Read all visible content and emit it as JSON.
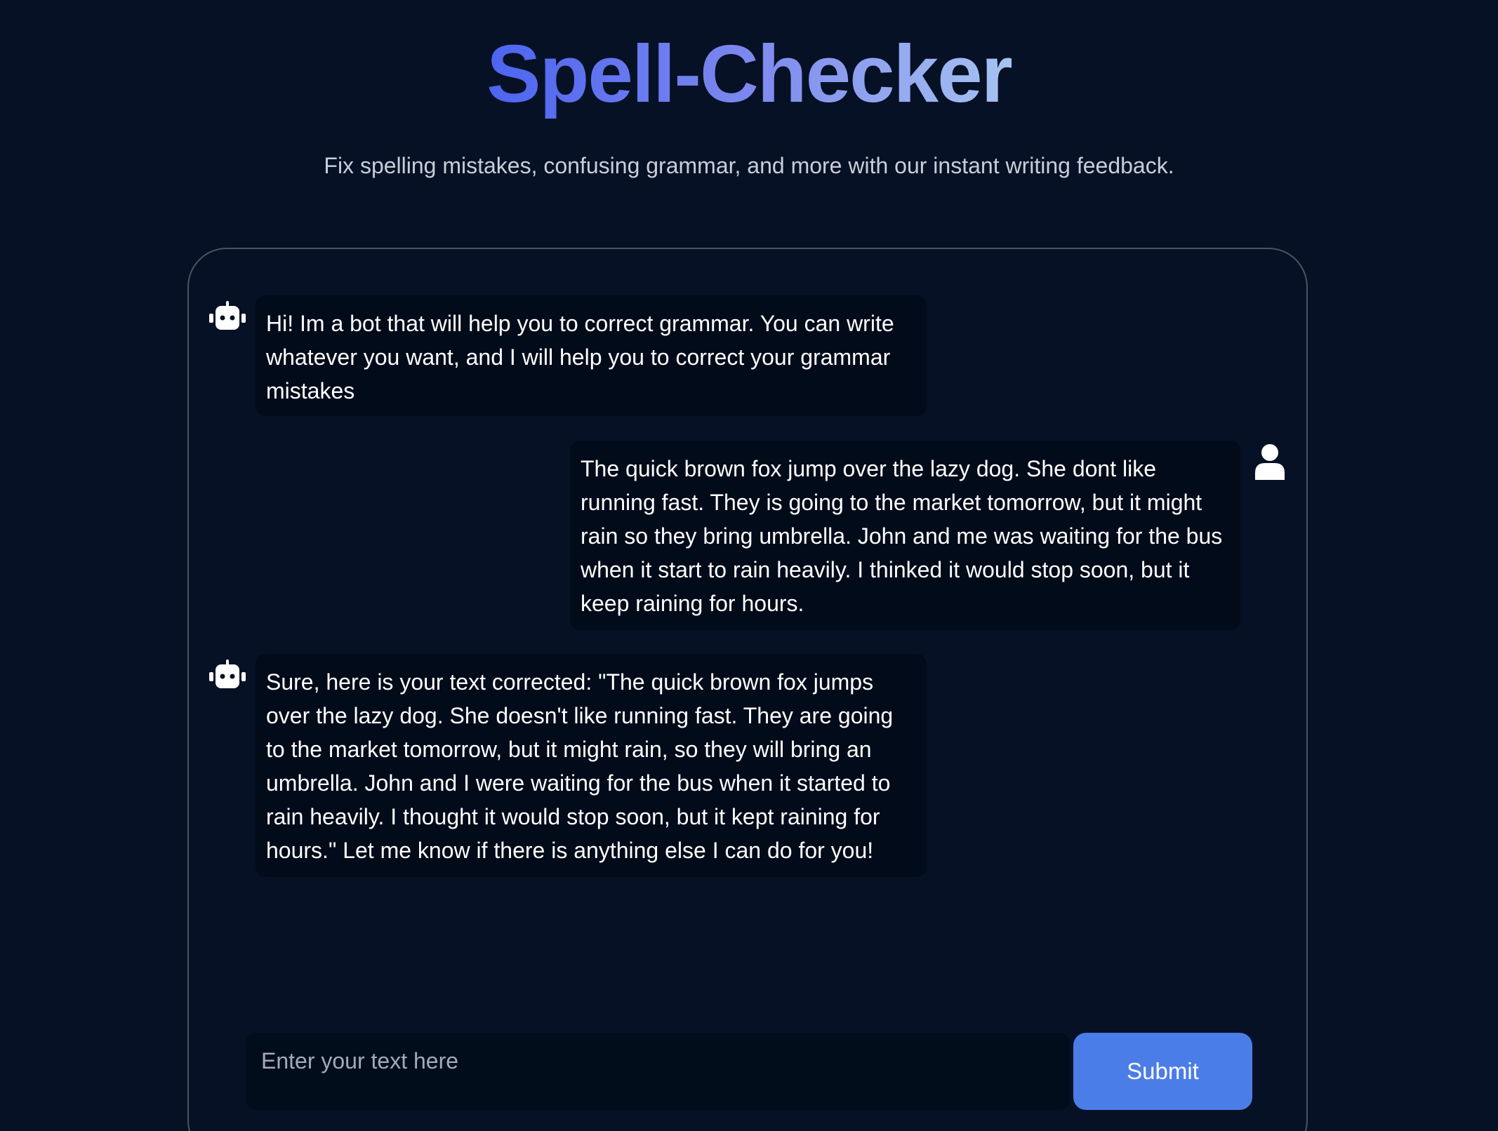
{
  "header": {
    "title": "Spell-Checker",
    "subtitle": "Fix spelling mistakes, confusing grammar, and more with our instant writing feedback."
  },
  "colors": {
    "background": "#061125",
    "title_gradient": [
      "#4c64f0",
      "#7d88ee",
      "#a6c3f2"
    ],
    "bubble_background": "#020b1a",
    "accent": "#4b7de8"
  },
  "chat": {
    "messages": [
      {
        "sender": "bot",
        "icon": "robot-icon",
        "text": "Hi! Im a bot that will help you to correct grammar. You can write whatever you want, and I will help you to correct your grammar mistakes"
      },
      {
        "sender": "user",
        "icon": "user-icon",
        "text": "The quick brown fox jump over the lazy dog. She dont like running fast. They is going to the market tomorrow, but it might rain so they bring umbrella. John and me was waiting for the bus when it start to rain heavily. I thinked it would stop soon, but it keep raining for hours."
      },
      {
        "sender": "bot",
        "icon": "robot-icon",
        "text": "Sure, here is your text corrected: \"The quick brown fox jumps over the lazy dog. She doesn't like running fast. They are going to the market tomorrow, but it might rain, so they will bring an umbrella. John and I were waiting for the bus when it started to rain heavily. I thought it would stop soon, but it kept raining for hours.\" Let me know if there is anything else I can do for you!"
      }
    ]
  },
  "composer": {
    "placeholder": "Enter your text here",
    "value": "",
    "submit_label": "Submit"
  }
}
